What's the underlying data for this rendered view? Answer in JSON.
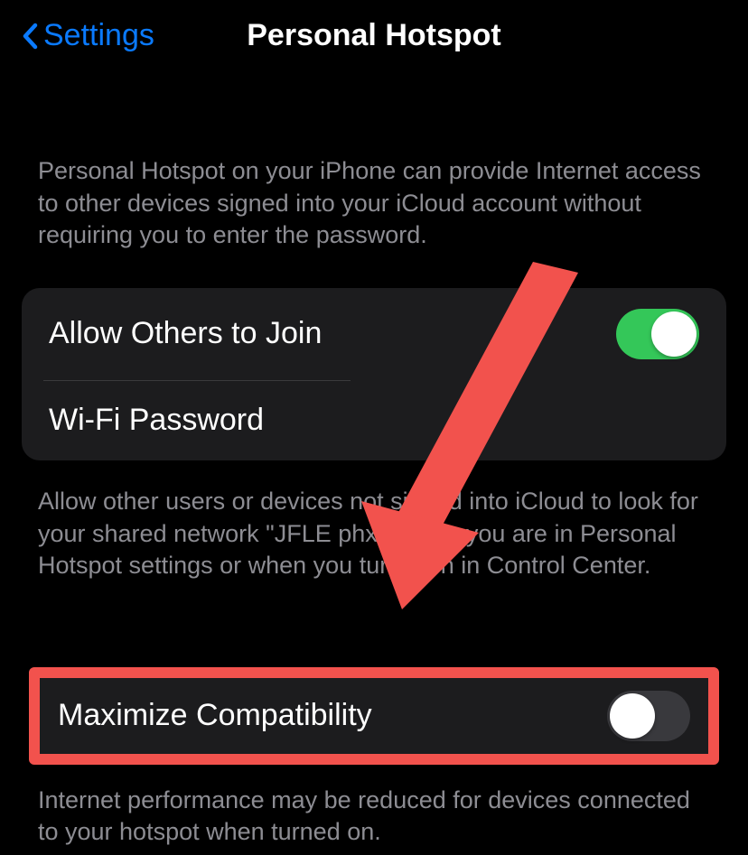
{
  "header": {
    "back_label": "Settings",
    "title": "Personal Hotspot"
  },
  "intro_text": "Personal Hotspot on your iPhone can provide Internet access to other devices signed into your iCloud account without requiring you to enter the password.",
  "group1": {
    "allow_others_label": "Allow Others to Join",
    "allow_others_on": true,
    "wifi_password_label": "Wi-Fi Password"
  },
  "group1_footer": "Allow other users or devices not signed into iCloud to look for your shared network \"JFLE phxr\" when you are in Personal Hotspot settings or when you turn it on in Control Center.",
  "group2": {
    "maximize_label": "Maximize Compatibility",
    "maximize_on": false
  },
  "group2_footer": "Internet performance may be reduced for devices connected to your hotspot when turned on."
}
